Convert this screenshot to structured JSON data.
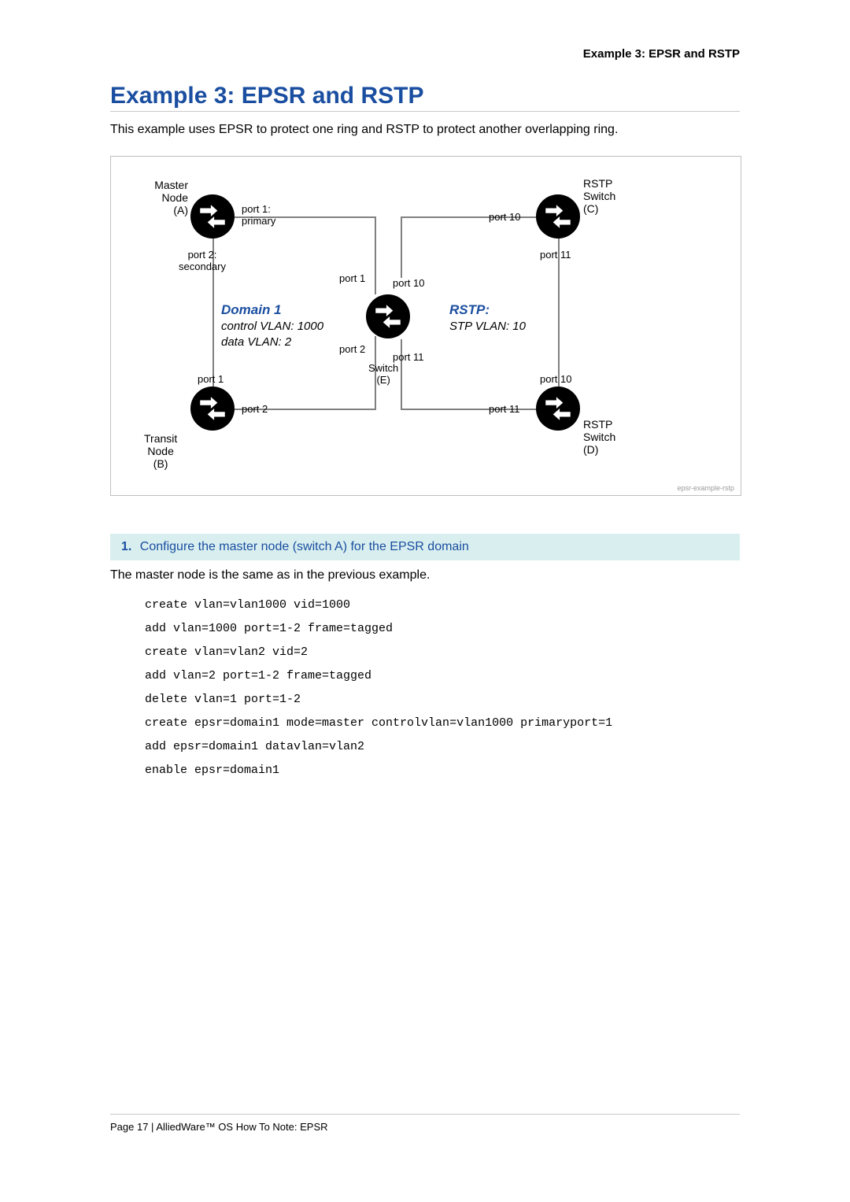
{
  "header": {
    "running_title": "Example 3: EPSR and RSTP"
  },
  "title": "Example 3: EPSR and RSTP",
  "intro": "This example uses EPSR to protect one ring and RSTP to protect another overlapping ring.",
  "diagram": {
    "nodes": {
      "A": {
        "label": "Master\nNode\n(A)",
        "ports": {
          "primary": "port 1:\nprimary",
          "secondary": "port 2:\nsecondary"
        }
      },
      "B": {
        "label": "Transit\nNode\n(B)",
        "ports": {
          "p1": "port 1",
          "p2": "port 2"
        }
      },
      "C": {
        "label": "RSTP\nSwitch\n(C)",
        "ports": {
          "p10": "port 10",
          "p11": "port 11"
        }
      },
      "D": {
        "label": "RSTP\nSwitch\n(D)",
        "ports": {
          "p10": "port 10",
          "p11": "port 11"
        }
      },
      "E": {
        "label": "Switch\n(E)",
        "ports": {
          "p1": "port 1",
          "p2": "port 2",
          "p10": "port 10",
          "p11": "port 11"
        }
      }
    },
    "domain1": {
      "title": "Domain 1",
      "control": "control VLAN: 1000",
      "data": "data VLAN: 2"
    },
    "rstp": {
      "title": "RSTP:",
      "vlan": "STP VLAN: 10"
    },
    "watermark": "epsr-example-rstp"
  },
  "step": {
    "number": "1.",
    "title": "Configure the master node (switch A) for the EPSR domain"
  },
  "body": {
    "para": "The master node is the same as in the previous example.",
    "code": "create vlan=vlan1000 vid=1000\nadd vlan=1000 port=1-2 frame=tagged\ncreate vlan=vlan2 vid=2\nadd vlan=2 port=1-2 frame=tagged\ndelete vlan=1 port=1-2\ncreate epsr=domain1 mode=master controlvlan=vlan1000 primaryport=1\nadd epsr=domain1 datavlan=vlan2\nenable epsr=domain1"
  },
  "footer": {
    "text": "Page 17 | AlliedWare™ OS How To Note: EPSR"
  }
}
